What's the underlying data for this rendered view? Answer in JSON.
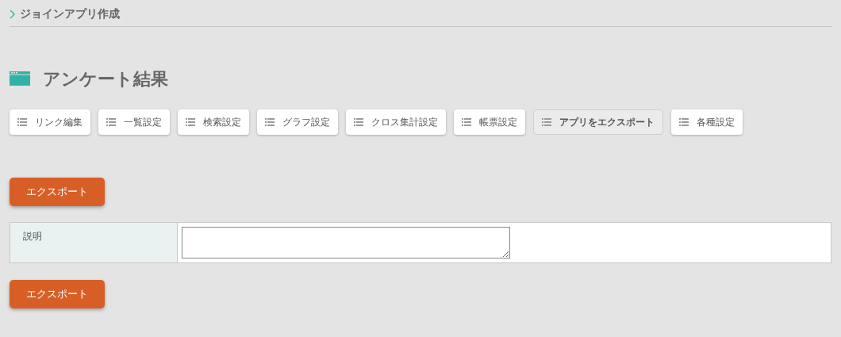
{
  "breadcrumb": {
    "label": "ジョインアプリ作成"
  },
  "page_title": "アンケート結果",
  "tabs": [
    {
      "label": "リンク編集",
      "selected": false
    },
    {
      "label": "一覧設定",
      "selected": false
    },
    {
      "label": "検索設定",
      "selected": false
    },
    {
      "label": "グラフ設定",
      "selected": false
    },
    {
      "label": "クロス集計設定",
      "selected": false
    },
    {
      "label": "帳票設定",
      "selected": false
    },
    {
      "label": "アプリをエクスポート",
      "selected": true
    },
    {
      "label": "各種設定",
      "selected": false
    }
  ],
  "export_button_top": "エクスポート",
  "form": {
    "rows": [
      {
        "label": "説明",
        "kind": "textarea"
      }
    ]
  },
  "export_button_bottom": "エクスポート"
}
